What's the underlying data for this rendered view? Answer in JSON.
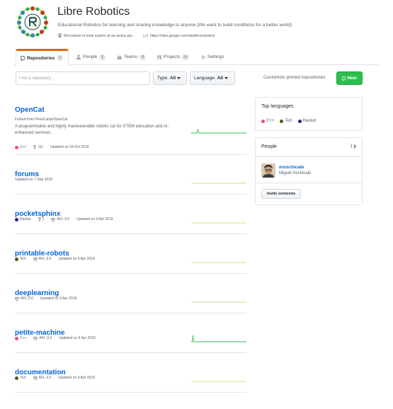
{
  "org": {
    "name": "Libre Robotics",
    "description": "Educational Robotics for learning and sharing knowledge to anyone (We want to build conditions for a better world)",
    "location": "third planet of solar system at via lactea gal...",
    "website": "https://sites.google.com/site/librerobotics/"
  },
  "tabs": [
    {
      "label": "Repositories",
      "count": "7"
    },
    {
      "label": "People",
      "count": "1"
    },
    {
      "label": "Teams",
      "count": "0"
    },
    {
      "label": "Projects",
      "count": "0"
    },
    {
      "label": "Settings",
      "count": ""
    }
  ],
  "filters": {
    "search_placeholder": "Find a repository...",
    "type_label": "Type:",
    "type_value": "All",
    "language_label": "Language:",
    "language_value": "All",
    "customize": "Customize pinned repositories",
    "new_label": "New"
  },
  "colors": {
    "C++": "#f34b7d",
    "TeX": "#3D6117",
    "Racket": "#22228f",
    "accent_orange": "#e36209",
    "link_blue": "#0366d6",
    "new_green": "#2cbe4e",
    "spark_green": "#2cbe4e"
  },
  "repos": [
    {
      "name": "OpenCat",
      "fork": "Forked from PetoiCamp/OpenCat",
      "description": "A programmable and highly maneuverable robotic cat for STEM education and AI-enhanced services.",
      "language": "C++",
      "forks": "111",
      "license": "",
      "updated": "Updated on 24 Oct 2018",
      "spark": "spike-small"
    },
    {
      "name": "forums",
      "fork": "",
      "description": "",
      "language": "",
      "forks": "",
      "license": "",
      "updated": "Updated on 7 Sep 2018",
      "spark": "flat"
    },
    {
      "name": "pocketsphinx",
      "fork": "",
      "description": "",
      "language": "Racket",
      "forks": "1",
      "license": "AFL-3.0",
      "updated": "Updated on 9 Apr 2018",
      "spark": "flat"
    },
    {
      "name": "printable-robots",
      "fork": "",
      "description": "",
      "language": "TeX",
      "forks": "",
      "license": "AFL-3.0",
      "updated": "Updated on 9 Apr 2018",
      "spark": "flat"
    },
    {
      "name": "deeplearning",
      "fork": "",
      "description": "",
      "language": "",
      "forks": "",
      "license": "AFL-3.0",
      "updated": "Updated on 9 Apr 2018",
      "spark": "flat"
    },
    {
      "name": "petite-machine",
      "fork": "",
      "description": "",
      "language": "C++",
      "forks": "",
      "license": "AFL-3.0",
      "updated": "Updated on 9 Apr 2018",
      "spark": "spike-large"
    },
    {
      "name": "documentation",
      "fork": "",
      "description": "",
      "language": "TeX",
      "forks": "",
      "license": "AFL-3.0",
      "updated": "Updated on 9 Apr 2018",
      "spark": "flat"
    }
  ],
  "sidebar": {
    "top_languages_title": "Top languages",
    "languages": [
      "C++",
      "TeX",
      "Racket"
    ],
    "people_title": "People",
    "people_count": "1",
    "member_login": "mxochicale",
    "member_name": "Miguel Xochicale",
    "invite_label": "Invite someone"
  }
}
